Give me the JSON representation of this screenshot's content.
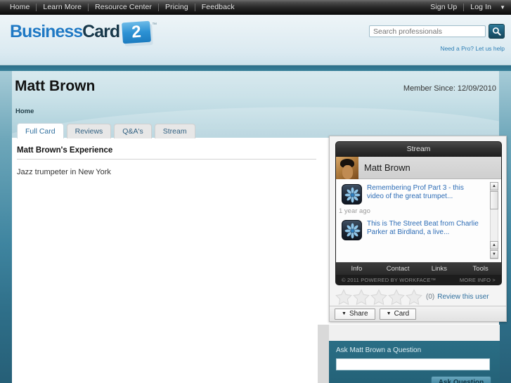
{
  "topnav": {
    "left_items": [
      {
        "label": "Home"
      },
      {
        "label": "Learn More"
      },
      {
        "label": "Resource Center"
      },
      {
        "label": "Pricing"
      },
      {
        "label": "Feedback"
      }
    ],
    "right_items": [
      {
        "label": "Sign Up"
      },
      {
        "label": "Log In"
      }
    ],
    "caret": "▼"
  },
  "header": {
    "logo_part1": "Business",
    "logo_part2": "Card",
    "logo_number": "2",
    "logo_tm": "™",
    "search_placeholder": "Search professionals",
    "search_value": "",
    "search_icon": "search-icon",
    "need_pro_link": "Need a Pro? Let us help"
  },
  "profile": {
    "name": "Matt Brown",
    "member_since": "Member Since: 12/09/2010",
    "breadcrumb": "Home"
  },
  "tabs": [
    {
      "label": "Full Card",
      "active": true
    },
    {
      "label": "Reviews",
      "active": false
    },
    {
      "label": "Q&A's",
      "active": false
    },
    {
      "label": "Stream",
      "active": false
    }
  ],
  "content": {
    "experience_title": "Matt Brown's Experience",
    "experience_body": "Jazz trumpeter in New York"
  },
  "widget": {
    "title": "Stream",
    "user_name": "Matt Brown",
    "stream_items": [
      {
        "text": "Remembering Prof Part 3 - this video of the great trumpet...",
        "time": "1 year ago"
      },
      {
        "text": "This is The Street Beat from Charlie Parker at Birdland, a live...",
        "time": ""
      }
    ],
    "nav": [
      {
        "label": "Info"
      },
      {
        "label": "Contact"
      },
      {
        "label": "Links"
      },
      {
        "label": "Tools"
      }
    ],
    "footer_left": "© 2011 POWERED BY WORKFACE™",
    "footer_right": "MORE INFO >",
    "scroll_up": "▲",
    "scroll_down": "▼",
    "rating_count": "(0)",
    "review_link": "Review this user",
    "stars": 5,
    "actions": [
      {
        "label": "Share",
        "caret": "▼"
      },
      {
        "label": "Card",
        "caret": "▼"
      }
    ]
  },
  "ask": {
    "label": "Ask Matt Brown a Question",
    "input_value": "",
    "input_placeholder": "",
    "button_label": "Ask Question"
  },
  "colors": {
    "accent_blue": "#2f6f9e",
    "teal": "#2c6f88",
    "logo_blue": "#1f79c4",
    "logo_dark": "#17384a",
    "nav_dark": "#262626"
  }
}
